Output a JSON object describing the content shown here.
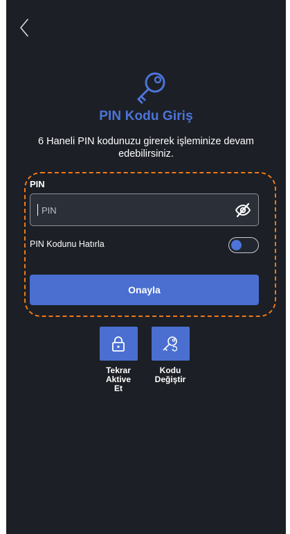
{
  "header": {
    "back_icon": "chevron-left-icon"
  },
  "hero": {
    "icon": "key-icon",
    "title": "PIN Kodu Giriş",
    "subtitle": "6 Haneli PIN kodunuzu girerek işleminize devam edebilirsiniz."
  },
  "form": {
    "pin_label": "PIN",
    "pin_placeholder": "PIN",
    "pin_value": "",
    "visibility_icon": "eye-off-icon",
    "remember_label": "PIN Kodunu Hatırla",
    "remember_enabled": false,
    "confirm_label": "Onayla"
  },
  "actions": [
    {
      "label": "Tekrar Aktive Et",
      "icon": "lock-icon"
    },
    {
      "label": "Kodu Değiştir",
      "icon": "key-refresh-icon"
    }
  ],
  "colors": {
    "background": "#1c1f25",
    "accent": "#4a6fd1",
    "title": "#4c74d9",
    "highlight_outline": "#f07a1a",
    "field_background": "#2a2f38"
  }
}
